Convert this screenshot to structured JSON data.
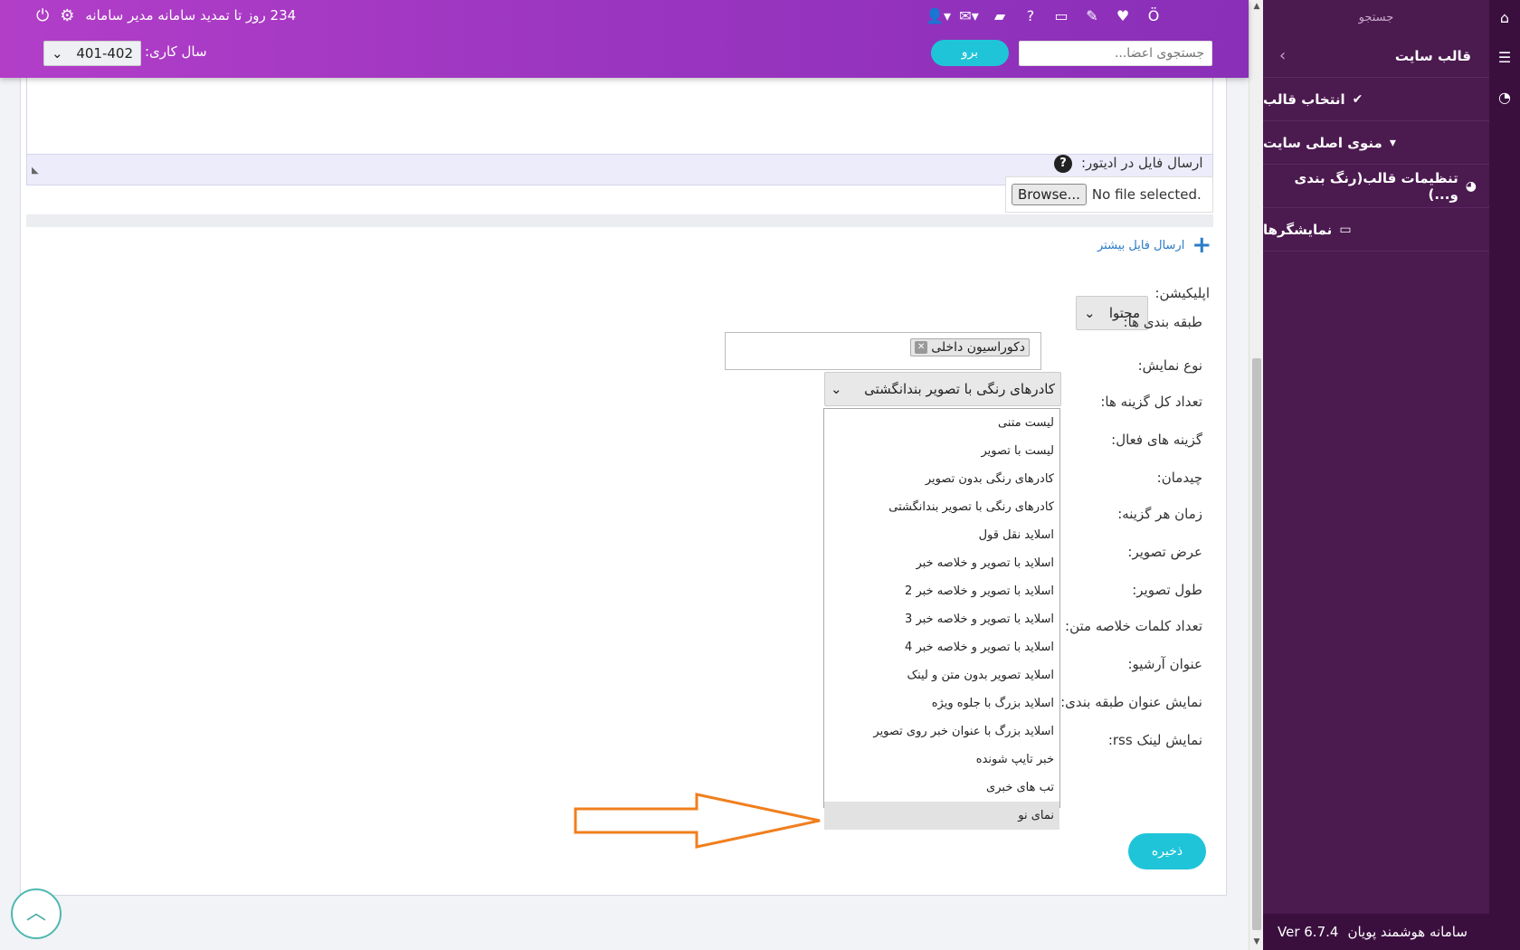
{
  "topbar": {
    "renewal_text": "234 روز تا تمدید سامانه مدیر سامانه",
    "search_placeholder": "جستجوی اعضا...",
    "go_label": "برو",
    "year_label": "سال کاری:",
    "year_value": "401-402"
  },
  "sidebar": {
    "search_label": "جستجو",
    "header": "قالب سایت",
    "items": [
      {
        "label": "انتخاب قالب",
        "icon": "check-circle-icon"
      },
      {
        "label": "منوی اصلی سایت",
        "icon": "caret-square-icon"
      },
      {
        "label": "تنظیمات قالب(رنگ بندی و...)",
        "icon": "palette-icon"
      },
      {
        "label": "نمایشگرها",
        "icon": "monitor-icon"
      }
    ],
    "footer": "سامانه هوشمند پویان",
    "version": "Ver 6.7.4"
  },
  "form": {
    "file_label": "ارسال فایل در ادیتور:",
    "browse_label": "Browse...",
    "file_status": "No file selected.",
    "add_more": "ارسال فایل بیشتر",
    "application_label": "اپلیکیشن:",
    "application_value": "محتوا",
    "categories_label": "طبقه بندی ها:",
    "category_tag": "دکوراسیون داخلی",
    "display_type_label": "نوع نمایش:",
    "display_type_value": "کادرهای رنگی با تصویر بندانگشتی",
    "total_items_label": "تعداد کل گزینه ها:",
    "active_items_label": "گزینه های فعال:",
    "layout_label": "چیدمان:",
    "item_time_label": "زمان هر گزینه:",
    "image_width_label": "عرض تصویر:",
    "image_height_label": "طول تصویر:",
    "summary_words_label": "تعداد کلمات خلاصه متن:",
    "archive_title_label": "عنوان آرشیو:",
    "show_category_title_label": "نمایش عنوان طبقه بندی:",
    "show_rss_label": "نمایش لینک rss:",
    "save_label": "ذخیره"
  },
  "dropdown_options": [
    "لیست متنی",
    "لیست با تصویر",
    "کادرهای رنگی بدون تصویر",
    "کادرهای رنگی با تصویر بندانگشتی",
    "اسلاید نقل قول",
    "اسلاید با تصویر و خلاصه خبر",
    "اسلاید با تصویر و خلاصه خبر 2",
    "اسلاید با تصویر و خلاصه خبر 3",
    "اسلاید با تصویر و خلاصه خبر 4",
    "اسلاید تصویر بدون متن و لینک",
    "اسلاید بزرگ با جلوه ویژه",
    "اسلاید بزرگ با عنوان خبر روی تصویر",
    "خبر تایپ شونده",
    "تب های خبری",
    "نمای نو"
  ],
  "highlighted_option": "نمای نو",
  "colors": {
    "topbar": "#9a35c0",
    "sidebar": "#4b1a4f",
    "accent": "#1fc4d8",
    "arrow": "#f07f1e"
  }
}
